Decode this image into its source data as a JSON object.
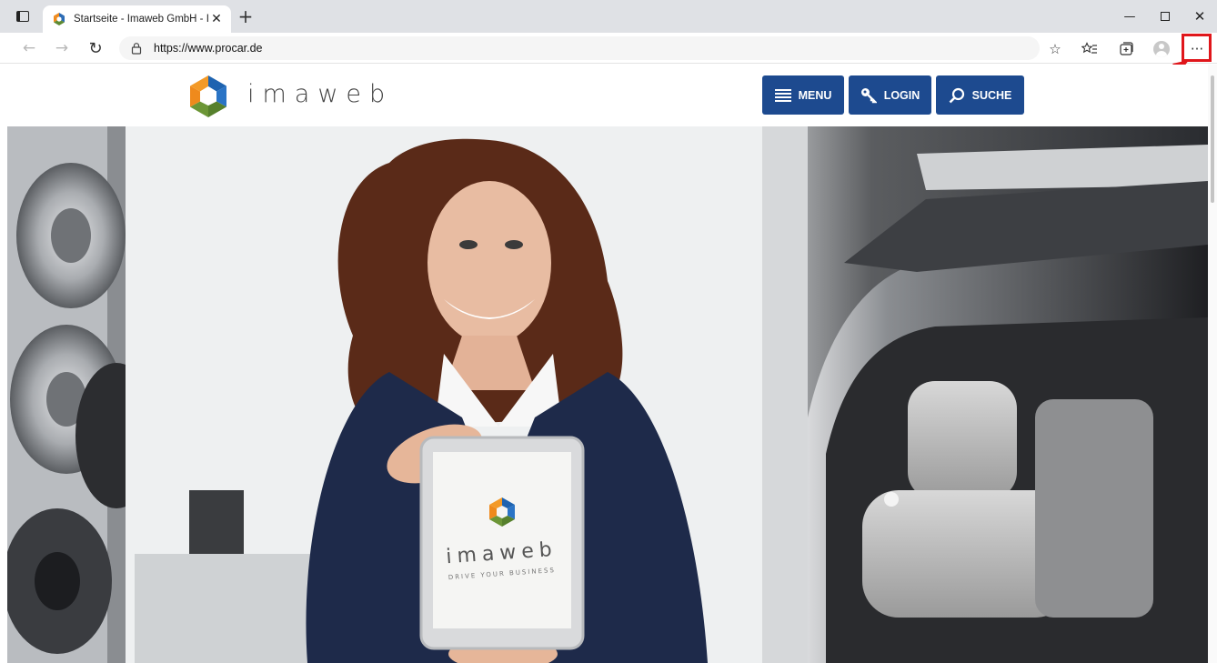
{
  "browser": {
    "tab_title": "Startseite - Imaweb GmbH - Ima",
    "url": "https://www.procar.de",
    "icons": {
      "tab_actions": "tab-actions-icon",
      "close_tab": "close-icon",
      "new_tab": "plus-icon",
      "back": "back-arrow-icon",
      "forward": "forward-arrow-icon",
      "reload": "reload-icon",
      "lock": "lock-icon",
      "add_favorite": "star-plus-icon",
      "favorites": "favorites-icon",
      "collections": "collections-icon",
      "profile": "profile-icon",
      "more": "ellipsis-icon"
    },
    "highlight_color": "#e0161b"
  },
  "site": {
    "brand": "imaweb",
    "nav": {
      "menu": "MENU",
      "login": "LOGIN",
      "search": "SUCHE"
    },
    "accent": "#1d4a8f",
    "tablet_brand": "imaweb",
    "tablet_tagline": "DRIVE YOUR BUSINESS"
  }
}
